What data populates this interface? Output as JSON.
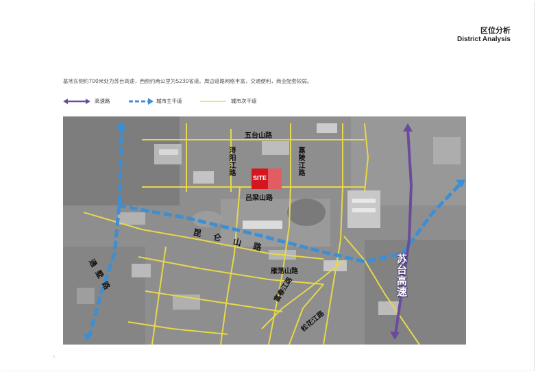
{
  "header": {
    "title_cn": "区位分析",
    "title_en": "District Analysis"
  },
  "description": "基地东侧约700米处为苏台高速，西侧约两公里为S230省道。周边道路网络丰富，交通便利，商业配套较弱。",
  "legend": [
    {
      "label": "高速路",
      "color": "#6a4b9c",
      "style": "double-arrow"
    },
    {
      "label": "城市主干道",
      "color": "#3b8fd6",
      "style": "dashed-arrow"
    },
    {
      "label": "城市次干道",
      "color": "#e7d84a",
      "style": "line"
    }
  ],
  "map": {
    "colors": {
      "expressway": "#6a4b9c",
      "main_road": "#3b8fd6",
      "secondary_road": "#e7d84a",
      "site": "#d4161f"
    },
    "site_label": "SITE",
    "road_labels": {
      "wutaishan": "五台山路",
      "xunyangjiang": "浔阳江路",
      "jialingjiang": "嘉陵江路",
      "lvliangshan": "吕梁山路",
      "kunlunshan": "昆仑山路",
      "tongyu": "通墅路",
      "yandangshan": "雁荡山路",
      "fuchunjiang": "富春江路",
      "songhuajiang": "松花江路",
      "expressway": "苏台高速"
    }
  }
}
